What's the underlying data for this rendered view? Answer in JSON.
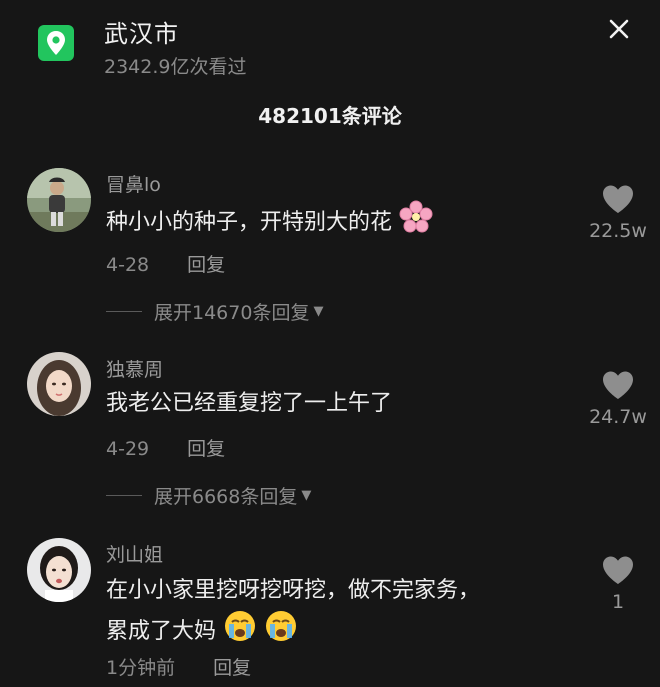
{
  "header": {
    "location": "武汉市",
    "views": "2342.9亿次看过",
    "icon": "location-pin-icon",
    "close_icon": "close-icon"
  },
  "comment_count": "482101条评论",
  "comments": [
    {
      "user": "冒鼻lo",
      "text": "种小小的种子，开特别大的花",
      "date": "4-28",
      "reply_label": "回复",
      "likes": "22.5w",
      "expand": "展开14670条回复"
    },
    {
      "user": "独慕周",
      "text": "我老公已经重复挖了一上午了",
      "date": "4-29",
      "reply_label": "回复",
      "likes": "24.7w",
      "expand": "展开6668条回复"
    },
    {
      "user": "刘山姐",
      "text_line1": "在小小家里挖呀挖呀挖，做不完家务，",
      "text_line2": "累成了大妈",
      "date": "1分钟前",
      "reply_label": "回复",
      "likes": "1"
    }
  ],
  "colors": {
    "accent": "#22c55e",
    "background": "#161616"
  }
}
